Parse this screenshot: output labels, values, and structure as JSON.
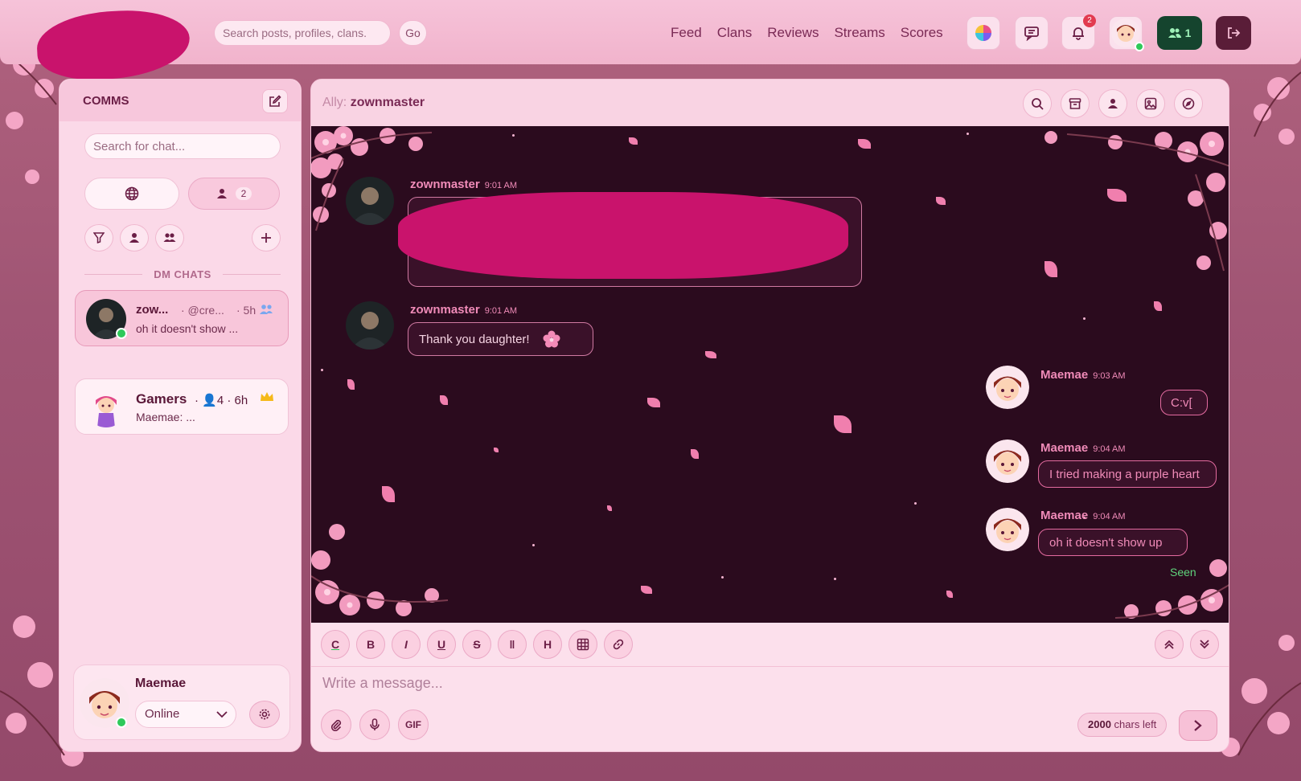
{
  "topbar": {
    "search_placeholder": "Search posts, profiles, clans.",
    "go_label": "Go",
    "nav": [
      "Feed",
      "Clans",
      "Reviews",
      "Streams",
      "Scores"
    ],
    "notification_count": "2",
    "friends_online": "1"
  },
  "sidebar": {
    "title": "COMMS",
    "search_placeholder": "Search for chat...",
    "direct_count": "2",
    "section_label": "DM CHATS",
    "chats": [
      {
        "name": "zow...",
        "handle": "· @cre...",
        "time": "· 5h",
        "preview": "oh it doesn't show ..."
      },
      {
        "name": "Gamers",
        "members": "· 👤4 · 6h",
        "preview": "Maemae: ..."
      }
    ],
    "user": {
      "name": "Maemae",
      "status": "Online"
    }
  },
  "chat": {
    "ally_label": "Ally:",
    "ally_name": "zownmaster",
    "messages": [
      {
        "author": "zownmaster",
        "time": "9:01 AM",
        "text": ""
      },
      {
        "author": "zownmaster",
        "time": "9:01 AM",
        "text": "Thank you daughter!"
      },
      {
        "author": "Maemae",
        "time": "9:03 AM",
        "text": "C:v["
      },
      {
        "author": "Maemae",
        "time": "9:04 AM",
        "text": "I tried making a purple heart"
      },
      {
        "author": "Maemae",
        "time": "9:04 AM",
        "text": "oh it doesn't show up"
      }
    ],
    "seen_label": "Seen"
  },
  "composer": {
    "format_buttons": [
      "C",
      "B",
      "I",
      "U",
      "S",
      "‖",
      "H",
      "▦",
      "🔗"
    ],
    "placeholder": "Write a message...",
    "gif_label": "GIF",
    "chars_count": "2000",
    "chars_suffix": "chars left"
  },
  "colors": {
    "accent_pink": "#f08bb8",
    "chat_bg": "#2b0b1e",
    "panel_bg": "#fbd9e8",
    "online_green": "#2ec95a",
    "seen_green": "#5fd47c"
  }
}
